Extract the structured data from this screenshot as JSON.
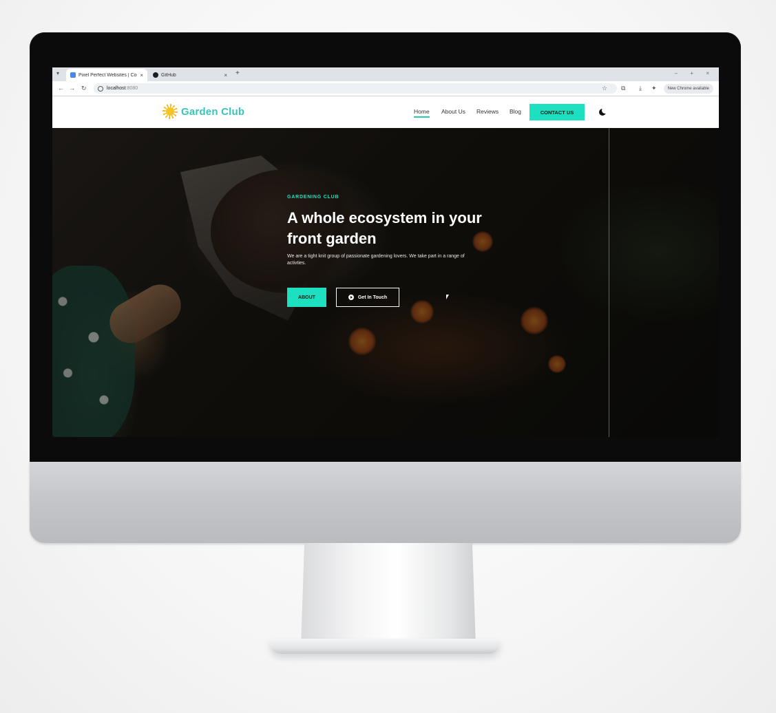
{
  "browser": {
    "tabs": [
      {
        "title": "Pixel Perfect Websites | Cod...",
        "active": true
      },
      {
        "title": "GitHub",
        "active": false
      }
    ],
    "new_tab_symbol": "+",
    "address": {
      "host": "localhost",
      "port": ":8080"
    },
    "update_label": "New Chrome available"
  },
  "site": {
    "brand": "Garden Club",
    "nav": {
      "home": "Home",
      "about": "About Us",
      "reviews": "Reviews",
      "blog": "Blog",
      "contact": "CONTACT US"
    }
  },
  "hero": {
    "eyebrow": "GARDENING CLUB",
    "headline": "A whole ecosystem in your front garden",
    "subtext": "We are a tight knit group of passionate gardening lovers. We take part in a range of activties.",
    "about_label": "ABOUT",
    "touch_label": "Get In Touch"
  },
  "colors": {
    "accent": "#1de0c0",
    "brand_text": "#35c6b8",
    "sun": "#f7c325"
  }
}
